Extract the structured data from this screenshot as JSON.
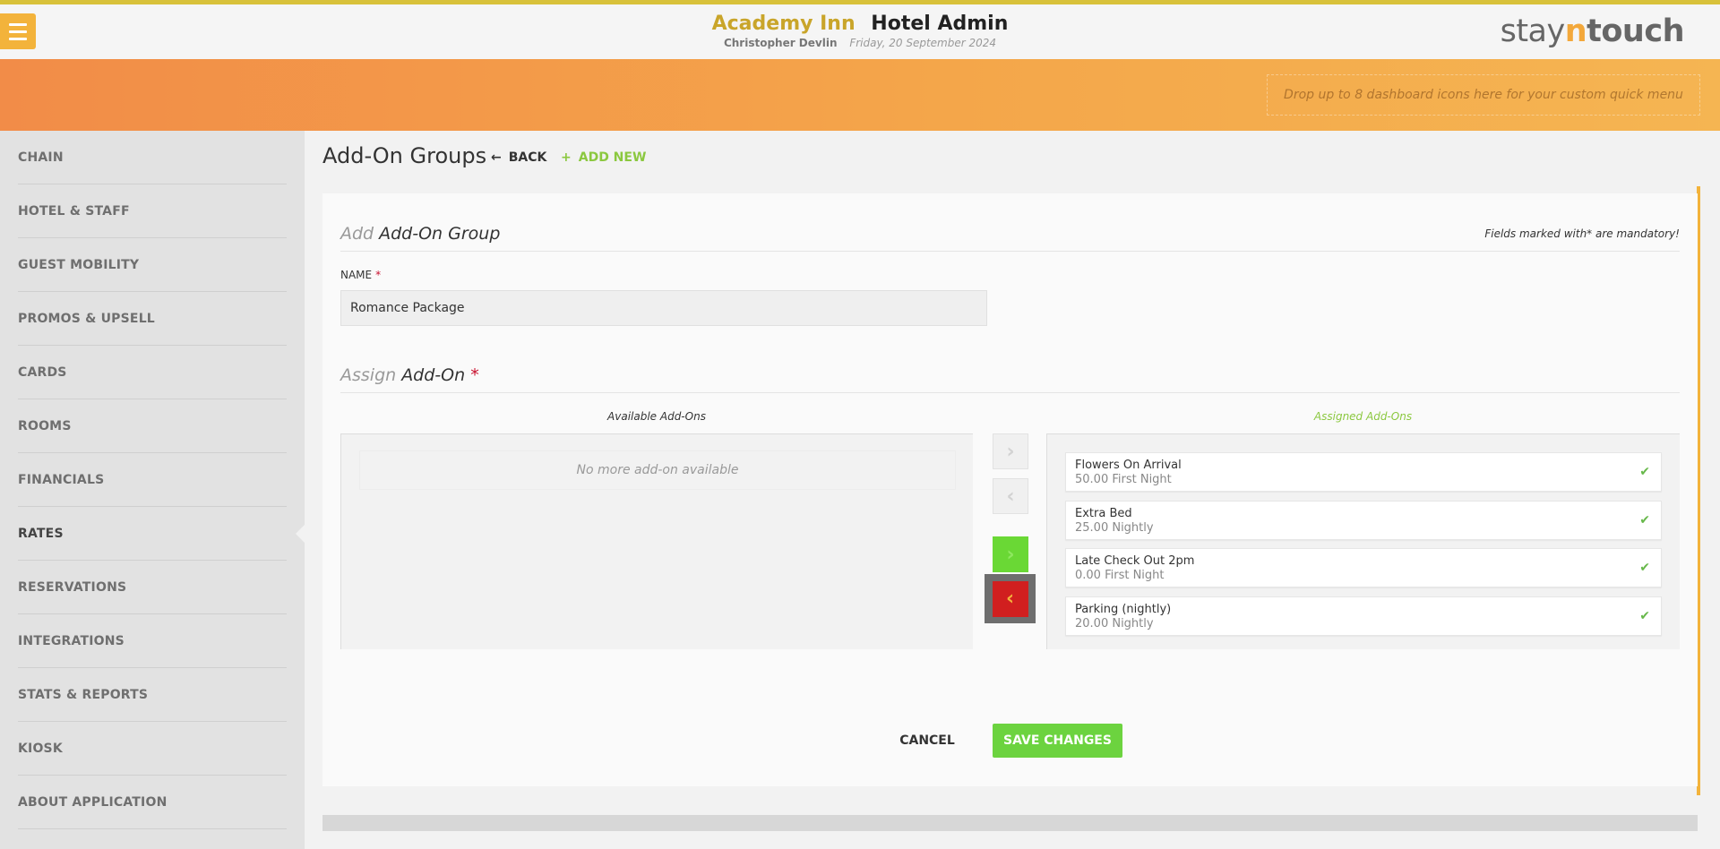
{
  "header": {
    "hotel_name": "Academy Inn",
    "app_title": "Hotel Admin",
    "user_name": "Christopher Devlin",
    "date": "Friday, 20 September 2024",
    "logo": {
      "part1": "stay",
      "part2": "n",
      "part3": "touch"
    },
    "menu_icon": "hamburger-icon"
  },
  "banner": {
    "quick_menu_hint": "Drop up to 8 dashboard icons here for your custom quick menu"
  },
  "sidebar": {
    "items": [
      {
        "label": "CHAIN"
      },
      {
        "label": "HOTEL & STAFF"
      },
      {
        "label": "GUEST MOBILITY"
      },
      {
        "label": "PROMOS & UPSELL"
      },
      {
        "label": "CARDS"
      },
      {
        "label": "ROOMS"
      },
      {
        "label": "FINANCIALS"
      },
      {
        "label": "RATES"
      },
      {
        "label": "RESERVATIONS"
      },
      {
        "label": "INTEGRATIONS"
      },
      {
        "label": "STATS & REPORTS"
      },
      {
        "label": "KIOSK"
      },
      {
        "label": "ABOUT APPLICATION"
      }
    ],
    "active": "RATES"
  },
  "page": {
    "title": "Add-On Groups",
    "back_label": "BACK",
    "add_new_label": "ADD NEW"
  },
  "form": {
    "heading_pre": "Add",
    "heading_main": "Add-On Group",
    "mandatory_note": "Fields marked with* are mandatory!",
    "name_label": "NAME",
    "required_mark": "*",
    "name_value": "Romance Package",
    "assign_pre": "Assign",
    "assign_main": "Add-On",
    "available_title": "Available Add-Ons",
    "assigned_title": "Assigned Add-Ons",
    "no_more_text": "No more add-on available",
    "assigned_items": [
      {
        "name": "Flowers On Arrival",
        "price": "50.00 First Night"
      },
      {
        "name": "Extra Bed",
        "price": "25.00 Nightly"
      },
      {
        "name": "Late Check Out 2pm",
        "price": "0.00 First Night"
      },
      {
        "name": "Parking (nightly)",
        "price": "20.00 Nightly"
      }
    ],
    "cancel_label": "CANCEL",
    "save_label": "SAVE CHANGES"
  },
  "colors": {
    "accent_orange": "#f3b33b",
    "hotel_gold": "#c9a52a",
    "green": "#6cd33f",
    "red": "#d11f1f",
    "required_red": "#c8102e"
  }
}
